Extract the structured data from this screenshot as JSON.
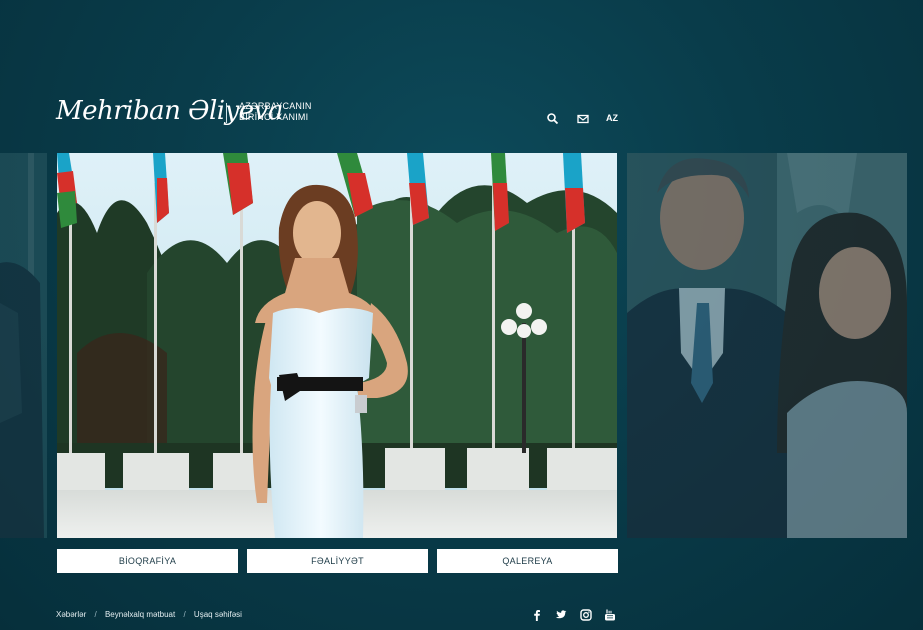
{
  "header": {
    "logo_text": "Mehriban Əliyeva",
    "tagline_line1": "AZƏRBAYCANIN",
    "tagline_line2": "BİRİNCİ XANIMI",
    "language": "AZ"
  },
  "icons": {
    "search": "search-icon",
    "mail": "mail-icon",
    "facebook": "facebook-icon",
    "twitter": "twitter-icon",
    "instagram": "instagram-icon",
    "youtube": "youtube-icon"
  },
  "tabs": [
    {
      "label": "BİOQRAFİYA"
    },
    {
      "label": "FƏALİYYƏT"
    },
    {
      "label": "QALEREYA"
    }
  ],
  "footer": {
    "links": [
      "Xəbərlər",
      "Beynəlxalq mətbuat",
      "Uşaq səhifəsi"
    ],
    "separator": "/"
  },
  "colors": {
    "background": "#093c4a",
    "tab_background": "#ffffff",
    "tab_text": "#1c3a46"
  }
}
